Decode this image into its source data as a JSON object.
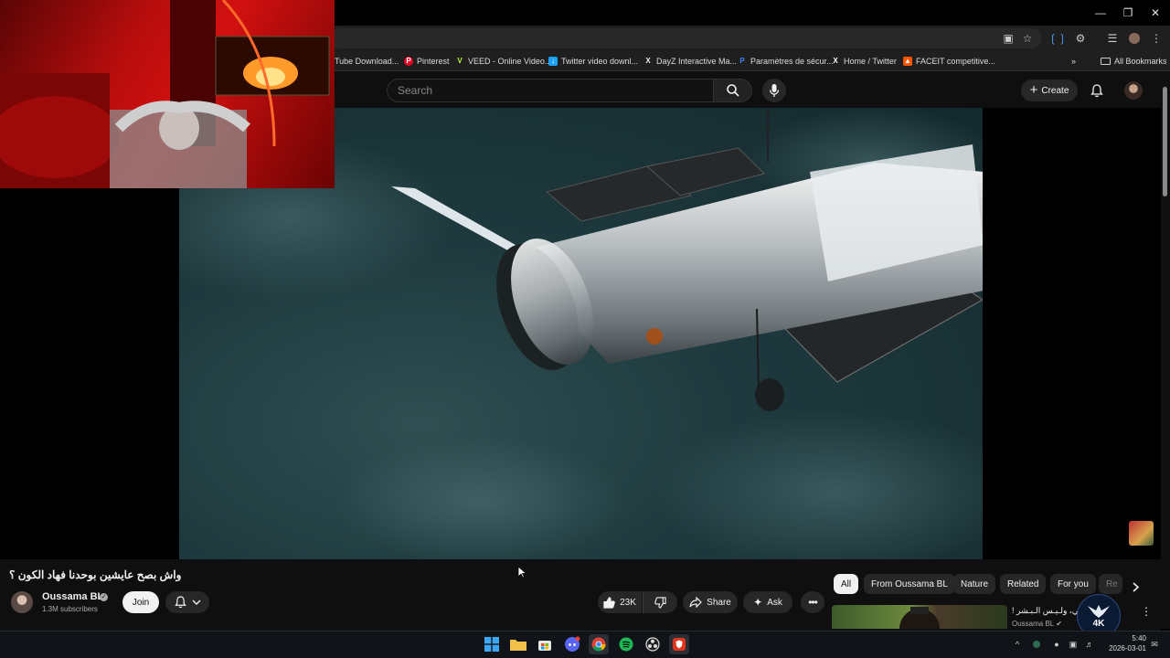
{
  "bookmarks": [
    {
      "label": "Tube Download...",
      "icon": "youtube-downloader-icon",
      "color": "#cc0000"
    },
    {
      "label": "Pinterest",
      "icon": "pinterest-icon",
      "color": "#e60023"
    },
    {
      "label": "VEED - Online Video...",
      "icon": "veed-icon",
      "color": "#b6ff3f"
    },
    {
      "label": "Twitter video downl...",
      "icon": "twitter-downloader-icon",
      "color": "#1da1f2"
    },
    {
      "label": "DayZ Interactive Ma...",
      "icon": "dayz-icon",
      "color": "#222222"
    },
    {
      "label": "Paramètres de sécur...",
      "icon": "paypal-icon",
      "color": "#0070e0"
    },
    {
      "label": "Home / Twitter",
      "icon": "x-icon",
      "color": "#000000"
    },
    {
      "label": "FACEIT competitive...",
      "icon": "faceit-icon",
      "color": "#ff5500"
    }
  ],
  "all_bookmarks": "All Bookmarks",
  "youtube": {
    "search_placeholder": "Search",
    "create_label": "Create"
  },
  "video": {
    "title": "واش بصح عايشين بوحدنا فهاد الكون ؟",
    "channel_name": "Oussama BL",
    "subscribers": "1.3M subscribers",
    "join_label": "Join",
    "likes": "23K",
    "share_label": "Share",
    "ask_label": "Ask"
  },
  "chips": [
    "All",
    "From Oussama BL",
    "Nature",
    "Related",
    "For you",
    "Re"
  ],
  "recommendation": {
    "title": "! مـ الـفـالـي، ولـيـس الـبـشر",
    "channel": "Oussama BL",
    "logo_text": "4K"
  },
  "clock": {
    "time": "5:40",
    "date": "2026-03-01"
  },
  "colors": {
    "youtube_bg": "#0f0f0f",
    "chip_bg": "#272727",
    "webcam_red": "#d21010"
  }
}
